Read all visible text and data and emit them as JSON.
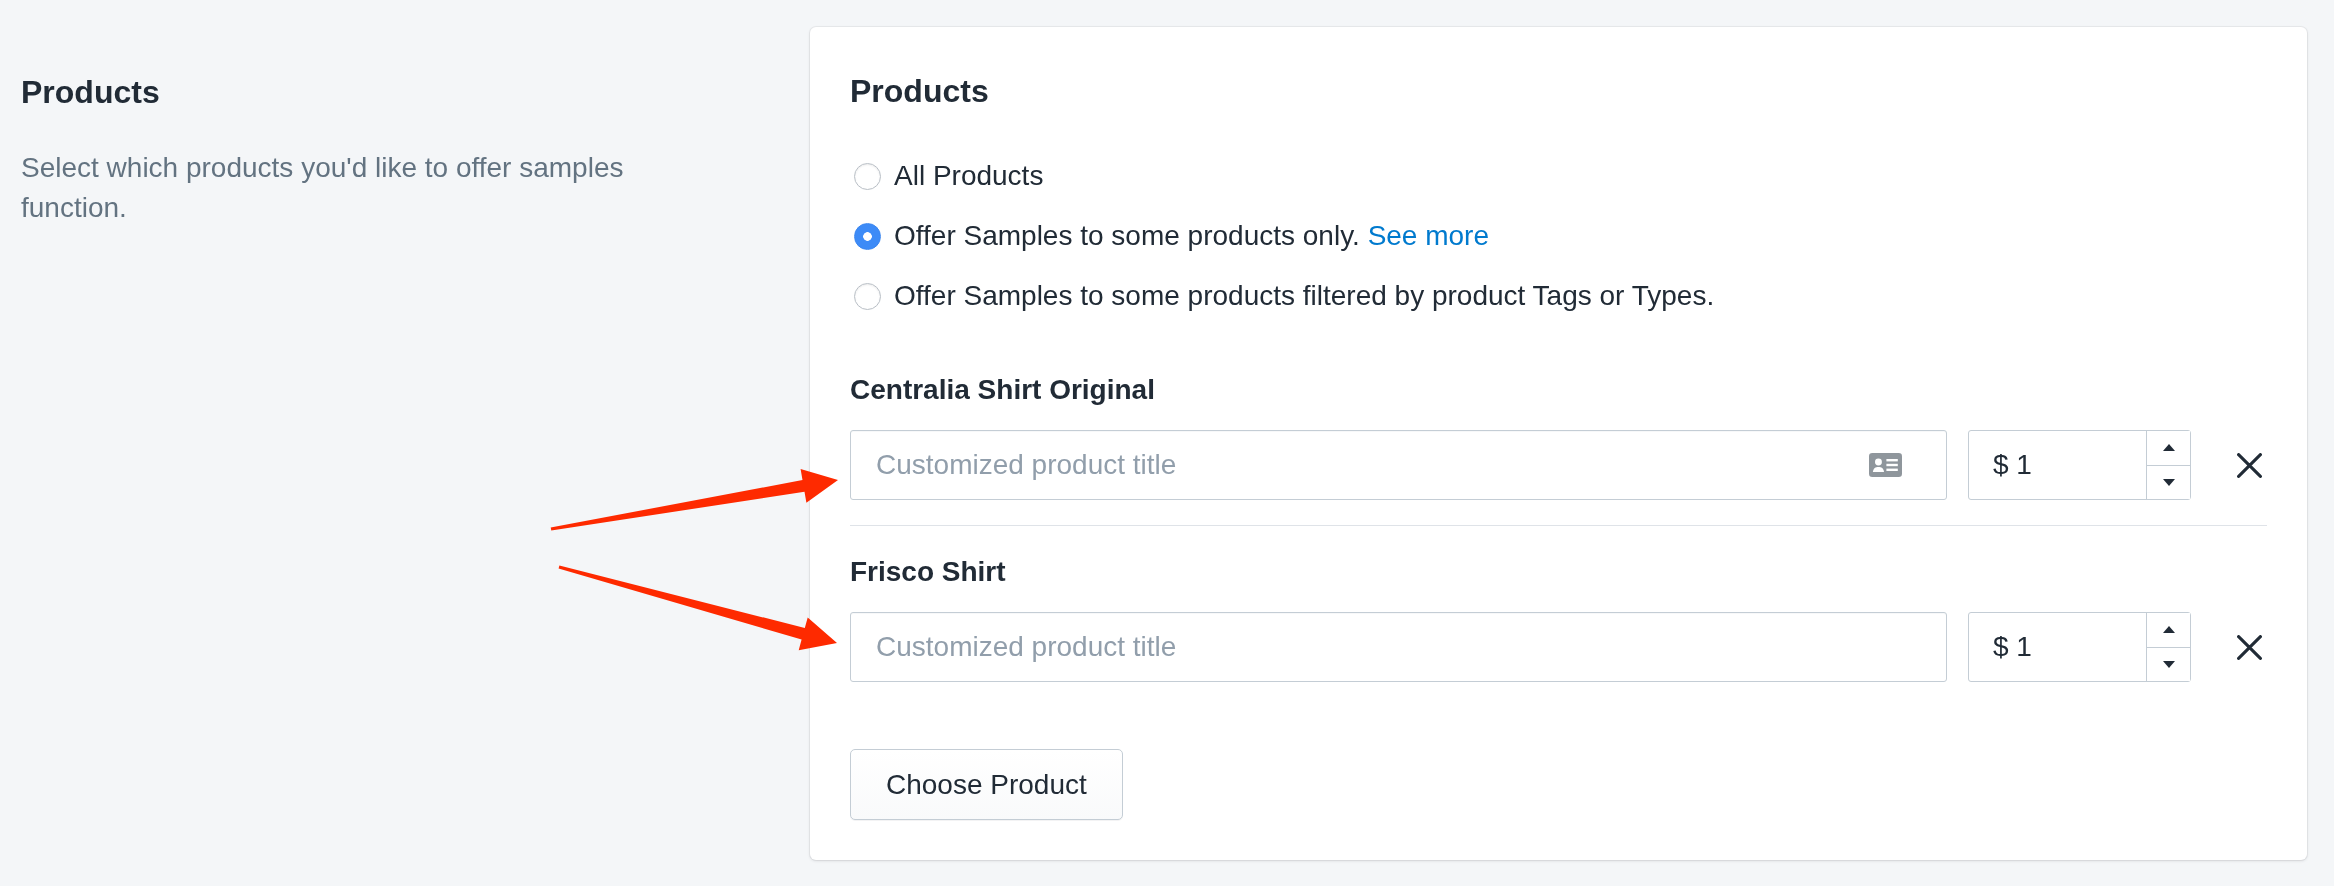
{
  "section": {
    "title": "Products",
    "description": "Select which products you'd like to offer samples function."
  },
  "card": {
    "title": "Products",
    "options": [
      {
        "label": "All Products",
        "selected": false
      },
      {
        "label": "Offer Samples to some products only.",
        "link": "See more",
        "selected": true
      },
      {
        "label": "Offer Samples to some products filtered by product Tags or Types.",
        "selected": false
      }
    ],
    "products": [
      {
        "name": "Centralia Shirt Original",
        "title_field": {
          "placeholder": "Customized product title"
        },
        "contact_icon": true,
        "price_field": {
          "value": "$ 1"
        },
        "pointed_by_arrow": true
      },
      {
        "name": "Frisco Shirt",
        "title_field": {
          "placeholder": "Customized product title"
        },
        "contact_icon": false,
        "price_field": {
          "value": "$ 1"
        },
        "pointed_by_arrow": true
      }
    ],
    "choose_button": "Choose Product"
  }
}
